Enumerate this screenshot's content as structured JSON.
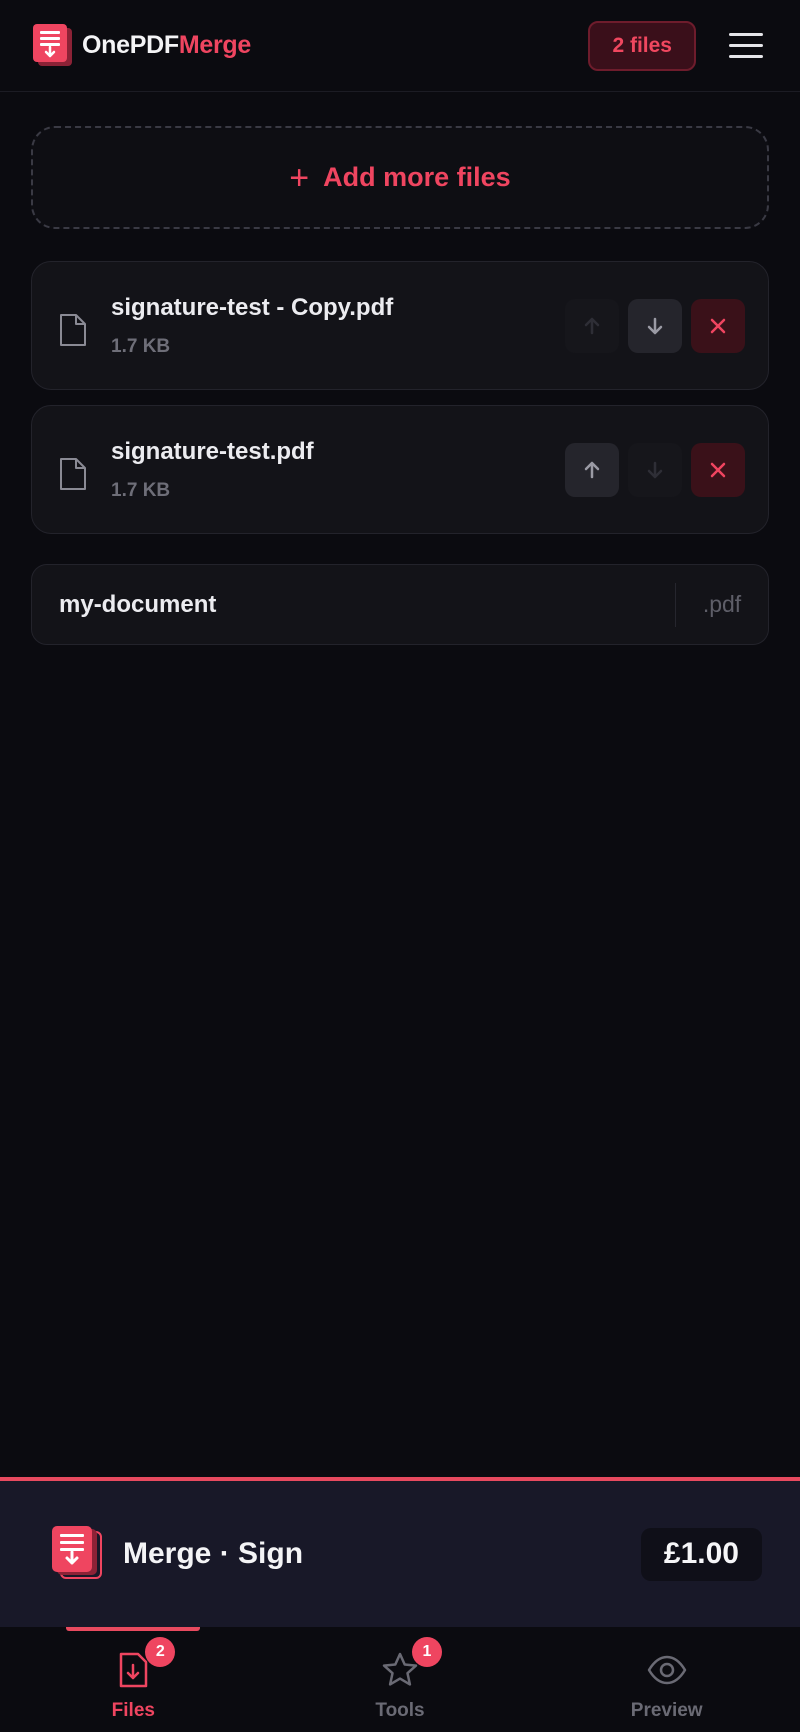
{
  "header": {
    "brand_part1": "OnePDF",
    "brand_part2": "Merge",
    "files_badge": "2 files"
  },
  "add_more": {
    "label": "Add more files"
  },
  "files": [
    {
      "name": "signature-test - Copy.pdf",
      "size": "1.7 KB",
      "can_move_up": false,
      "can_move_down": true
    },
    {
      "name": "signature-test.pdf",
      "size": "1.7 KB",
      "can_move_up": true,
      "can_move_down": false
    }
  ],
  "output": {
    "name": "my-document",
    "extension": ".pdf"
  },
  "merge_bar": {
    "label": "Merge · Sign",
    "price": "£1.00"
  },
  "bottom_nav": {
    "items": [
      {
        "label": "Files",
        "badge": "2",
        "active": true
      },
      {
        "label": "Tools",
        "badge": "1",
        "active": false
      },
      {
        "label": "Preview",
        "active": false
      }
    ]
  },
  "colors": {
    "accent": "#ef4560",
    "background": "#0b0b10",
    "card": "#131318",
    "merge_bar": "#181828"
  },
  "icons": {
    "logo": "pdf-stack-icon",
    "menu": "hamburger-menu-icon",
    "file": "document-icon",
    "move_up": "arrow-up-icon",
    "move_down": "arrow-down-icon",
    "remove": "close-icon",
    "tools": "star-icon",
    "preview": "eye-icon"
  }
}
